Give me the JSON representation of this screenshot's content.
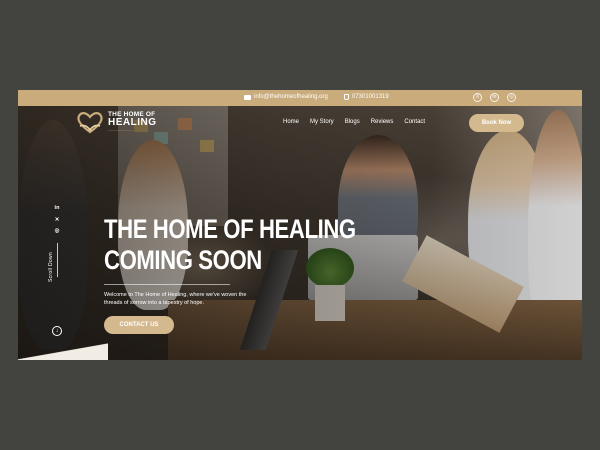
{
  "topbar": {
    "email": "info@thehomeofhealing.org",
    "phone": "07301001319",
    "socials": [
      {
        "icon": "x-icon",
        "label": "X"
      },
      {
        "icon": "linkedin-icon",
        "label": "in"
      },
      {
        "icon": "instagram-icon",
        "label": "◎"
      }
    ]
  },
  "header": {
    "logo_line1": "THE HOME OF",
    "logo_line2": "HEALING",
    "nav": [
      "Home",
      "My Story",
      "Blogs",
      "Reviews",
      "Contact"
    ],
    "book_button": "Book Now"
  },
  "side": {
    "socials": [
      "in",
      "✕",
      "◎"
    ],
    "scroll_label": "Scroll Down",
    "scroll_icon": "↓"
  },
  "hero": {
    "title_line1": "THE HOME OF HEALING",
    "title_line2": "COMING SOON",
    "subtitle": "Welcome to The Home of Healing, where we've woven the threads of sorrow into a tapestry of hope.",
    "cta": "CONTACT US"
  },
  "colors": {
    "accent": "#c9ab7c",
    "button": "#d4b98f",
    "outer_bg": "#434340"
  }
}
